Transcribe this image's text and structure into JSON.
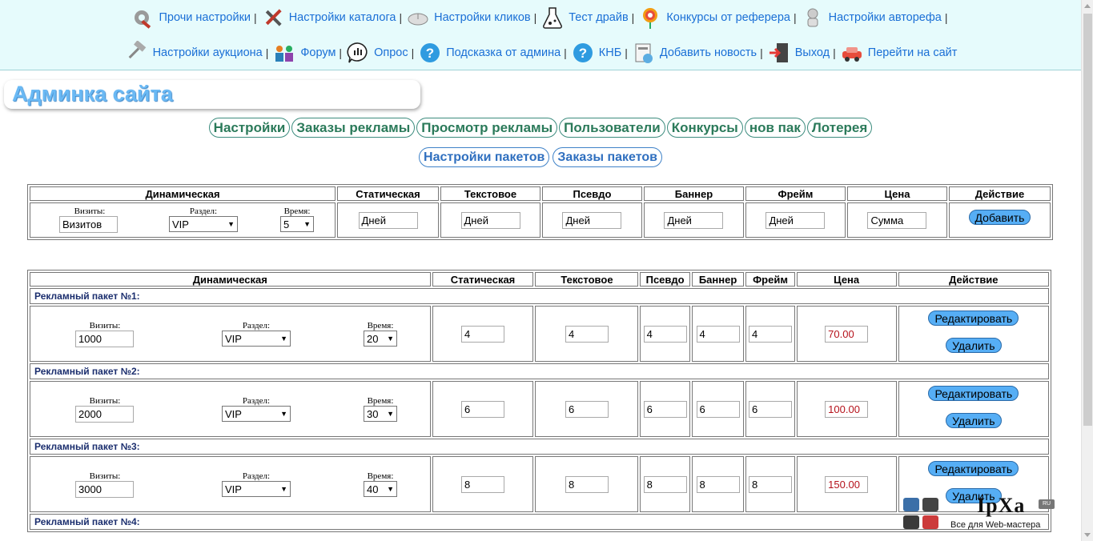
{
  "nav": {
    "row1": [
      {
        "label": "Прочи настройки",
        "icon": "tools-gear-icon"
      },
      {
        "label": "Настройки каталога",
        "icon": "hammer-wrench-icon"
      },
      {
        "label": "Настройки кликов",
        "icon": "mouse-icon"
      },
      {
        "label": "Тест драйв",
        "icon": "flask-icon"
      },
      {
        "label": "Конкурсы от реферера",
        "icon": "target-icon"
      },
      {
        "label": "Настройки авторефа",
        "icon": "robot-icon"
      }
    ],
    "row2": [
      {
        "label": "Настройки аукциона",
        "icon": "gavel-icon"
      },
      {
        "label": "Форум",
        "icon": "people-icon"
      },
      {
        "label": "Опрос",
        "icon": "poll-icon"
      },
      {
        "label": "Подсказка от админа",
        "icon": "help-icon"
      },
      {
        "label": "КНБ",
        "icon": "help-icon"
      },
      {
        "label": "Добавить новость",
        "icon": "news-icon"
      },
      {
        "label": "Выход",
        "icon": "exit-door-icon"
      },
      {
        "label": "Перейти на сайт",
        "icon": "car-icon"
      }
    ],
    "separator": "|"
  },
  "page_title": "Админка сайта",
  "menu_primary": [
    "Настройки",
    "Заказы рекламы",
    "Просмотр рекламы",
    "Пользователи",
    "Конкурсы",
    "нов пак",
    "Лотерея"
  ],
  "menu_secondary": [
    "Настройки пакетов",
    "Заказы пакетов"
  ],
  "add_form": {
    "headers": [
      "Динамическая",
      "Статическая",
      "Текстовое",
      "Псевдо",
      "Баннер",
      "Фрейм",
      "Цена",
      "Действие"
    ],
    "visits_label": "Визиты:",
    "visits_value": "Визитов",
    "section_label": "Раздел:",
    "section_value": "VIP",
    "time_label": "Время:",
    "time_value": "5",
    "static_value": "Дней",
    "text_value": "Дней",
    "pseudo_value": "Дней",
    "banner_value": "Дней",
    "frame_value": "Дней",
    "price_value": "Сумма",
    "add_button": "Добавить"
  },
  "packages": {
    "headers": [
      "Динамическая",
      "Статическая",
      "Текстовое",
      "Псевдо",
      "Баннер",
      "Фрейм",
      "Цена",
      "Действие"
    ],
    "visits_label": "Визиты:",
    "section_label": "Раздел:",
    "time_label": "Время:",
    "edit_button": "Редактировать",
    "delete_button": "Удалить",
    "items": [
      {
        "title": "Рекламный пакет №1:",
        "visits": "1000",
        "section": "VIP",
        "time": "20",
        "static": "4",
        "text": "4",
        "pseudo": "4",
        "banner": "4",
        "frame": "4",
        "price": "70.00"
      },
      {
        "title": "Рекламный пакет №2:",
        "visits": "2000",
        "section": "VIP",
        "time": "30",
        "static": "6",
        "text": "6",
        "pseudo": "6",
        "banner": "6",
        "frame": "6",
        "price": "100.00"
      },
      {
        "title": "Рекламный пакет №3:",
        "visits": "3000",
        "section": "VIP",
        "time": "40",
        "static": "8",
        "text": "8",
        "pseudo": "8",
        "banner": "8",
        "frame": "8",
        "price": "150.00"
      },
      {
        "title": "Рекламный пакет №4:"
      }
    ]
  },
  "watermark": {
    "logo": "IpXa",
    "domain": "RU",
    "tagline": "Все для Web-мастера"
  },
  "colors": {
    "nav_link": "#1a6fd6",
    "topbar_bg": "#e6fbfc",
    "menu_pill_text": "#2b7a5a",
    "button_bg": "#56aef5",
    "price_text": "#b5121b",
    "package_title": "#1b2e6e"
  }
}
